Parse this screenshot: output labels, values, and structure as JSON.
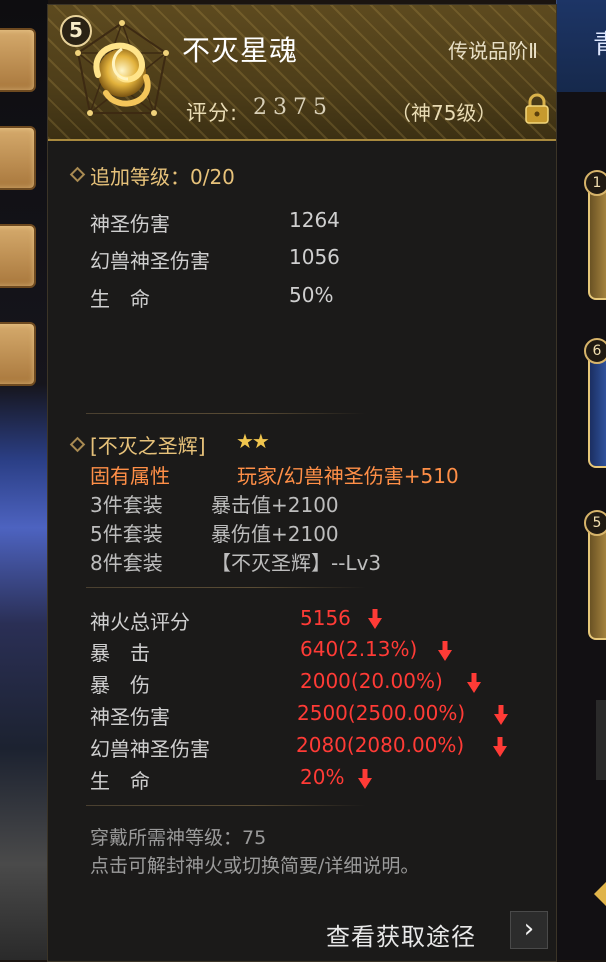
{
  "header": {
    "badge_number": "5",
    "item_name": "不灭星魂",
    "grade": "传说品阶Ⅱ",
    "score_label": "评分:",
    "score_value": "2375",
    "level_requirement": "（神75级）",
    "icon": "golden-swirl-orb-icon",
    "lock_icon": "lock-icon"
  },
  "enhance": {
    "title": "追加等级：0/20",
    "attributes": [
      {
        "name": "神圣伤害",
        "value": "1264"
      },
      {
        "name": "幻兽神圣伤害",
        "value": "1056"
      },
      {
        "name": "生　命",
        "value": "50%"
      }
    ]
  },
  "set": {
    "name": "[不灭之圣辉]",
    "stars": "★★",
    "lines": [
      {
        "label": "固有属性",
        "value": "玩家/幻兽神圣伤害+510"
      },
      {
        "label": "3件套装",
        "value": "暴击值+2100"
      },
      {
        "label": "5件套装",
        "value": "暴伤值+2100"
      },
      {
        "label": "8件套装",
        "value": "【不灭圣辉】--Lv3"
      }
    ]
  },
  "stats": [
    {
      "name": "神火总评分",
      "value": "5156"
    },
    {
      "name": "暴　击",
      "value": "640(2.13%)"
    },
    {
      "name": "暴　伤",
      "value": "2000(20.00%)"
    },
    {
      "name": "神圣伤害",
      "value": "2500(2500.00%)"
    },
    {
      "name": "幻兽神圣伤害",
      "value": "2080(2080.00%)"
    },
    {
      "name": "生　命",
      "value": "20%"
    }
  ],
  "footer": {
    "requirement": "穿戴所需神等级：75",
    "hint": "点击可解封神火或切换简要/详细说明。",
    "source_link": "查看获取途径",
    "source_arrow": "›"
  },
  "background": {
    "right_top_glyph": "青",
    "right_card_numbers": [
      "1",
      "6",
      "5"
    ]
  },
  "colors": {
    "gold_text": "#e7c27a",
    "orange_text": "#ff8f47",
    "red_value": "#ff3b36",
    "panel_bg": "#1b1a19",
    "header_bg": "#4e3e19"
  }
}
